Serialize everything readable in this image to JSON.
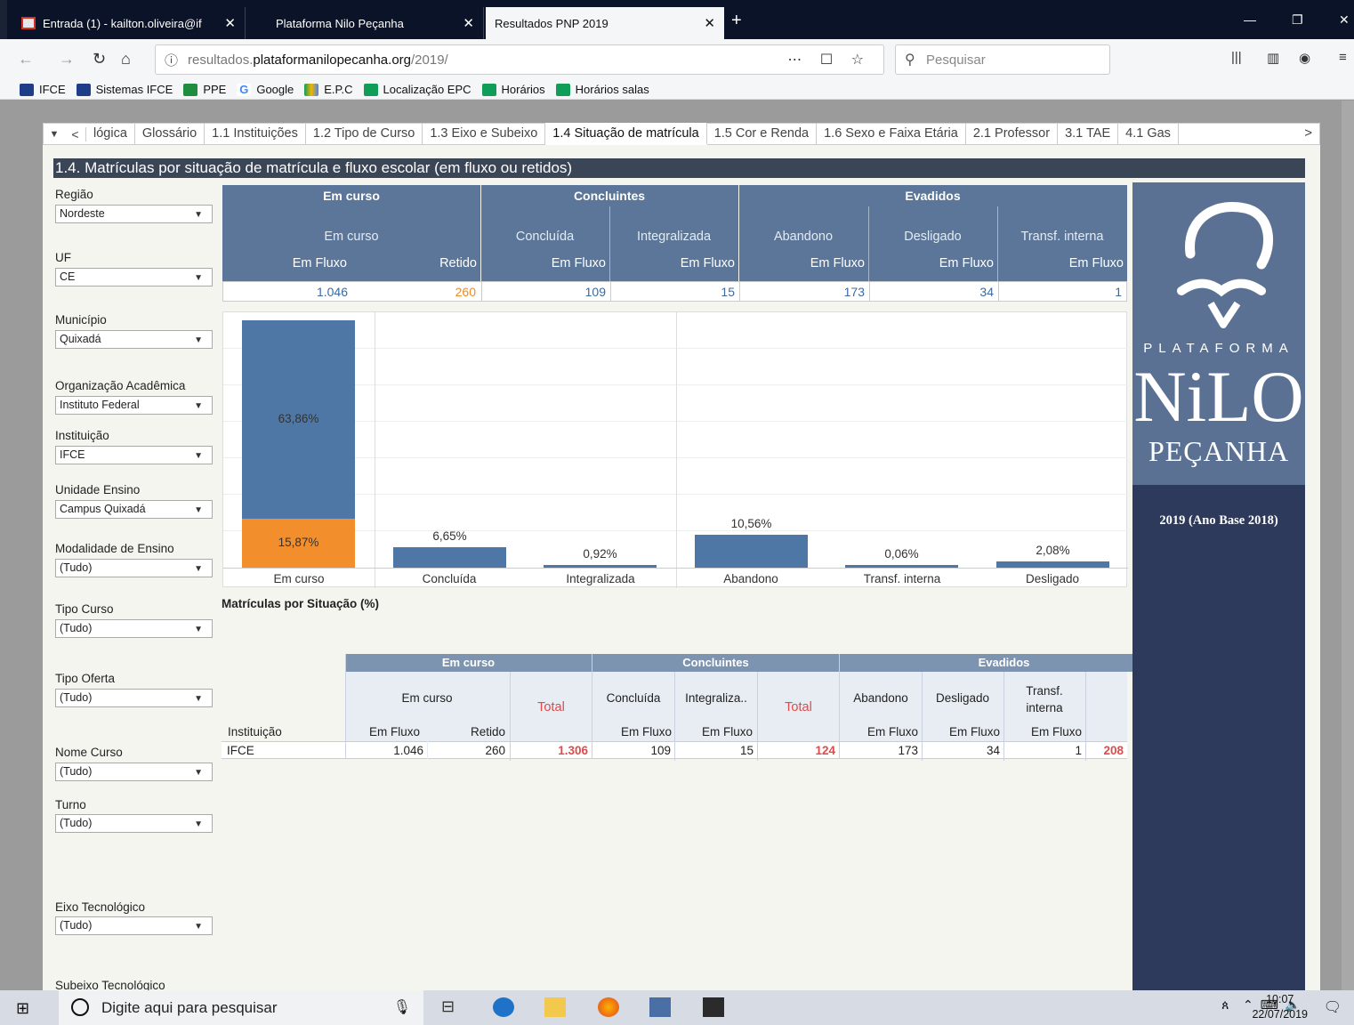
{
  "browser": {
    "tabs": [
      {
        "title": "Entrada (1) - kailton.oliveira@if"
      },
      {
        "title": "Plataforma Nilo Peçanha"
      },
      {
        "title": "Resultados PNP 2019"
      }
    ],
    "url_prefix": "resultados.",
    "url_domain": "plataformanilopecanha.org",
    "url_path": "/2019/",
    "search_placeholder": "Pesquisar",
    "bookmarks": [
      {
        "label": "IFCE",
        "color": "#1f3c88"
      },
      {
        "label": "Sistemas IFCE",
        "color": "#1f3c88"
      },
      {
        "label": "PPE",
        "color": "#1e8e3e"
      },
      {
        "label": "Google",
        "color": "#4285f4"
      },
      {
        "label": "E.P.C",
        "color": "#f4b400"
      },
      {
        "label": "Localização EPC",
        "color": "#0f9d58"
      },
      {
        "label": "Horários",
        "color": "#0f9d58"
      },
      {
        "label": "Horários salas",
        "color": "#0f9d58"
      }
    ]
  },
  "sheet_tabs": [
    "lógica",
    "Glossário",
    "1.1 Instituições",
    "1.2 Tipo de Curso",
    "1.3 Eixo e Subeixo",
    "1.4 Situação de matrícula",
    "1.5 Cor e Renda",
    "1.6 Sexo e Faixa Etária",
    "2.1 Professor",
    "3.1 TAE",
    "4.1 Gas"
  ],
  "dashboard_title": "1.4. Matrículas por situação de matrícula e fluxo escolar (em fluxo ou retidos)",
  "filters": [
    {
      "label": "Região",
      "value": "Nordeste"
    },
    {
      "label": "UF",
      "value": "CE"
    },
    {
      "label": "Município",
      "value": "Quixadá"
    },
    {
      "label": "Organização Acadêmica",
      "value": "Instituto Federal"
    },
    {
      "label": "Instituição",
      "value": "IFCE"
    },
    {
      "label": "Unidade Ensino",
      "value": "Campus Quixadá"
    },
    {
      "label": "Modalidade de Ensino",
      "value": "(Tudo)"
    },
    {
      "label": "Tipo Curso",
      "value": "(Tudo)"
    },
    {
      "label": "Tipo Oferta",
      "value": "(Tudo)"
    },
    {
      "label": "Nome Curso",
      "value": "(Tudo)"
    },
    {
      "label": "Turno",
      "value": "(Tudo)"
    },
    {
      "label": "Eixo Tecnológico",
      "value": "(Tudo)"
    },
    {
      "label": "Subeixo Tecnológico",
      "value": ""
    }
  ],
  "summary": {
    "groups": [
      "Em curso",
      "Concluintes",
      "Evadidos"
    ],
    "subs": [
      "Em curso",
      "Concluída",
      "Integralizada",
      "Abandono",
      "Desligado",
      "Transf. interna"
    ],
    "flux": [
      "Em Fluxo",
      "Retido",
      "Em Fluxo",
      "Em Fluxo",
      "Em Fluxo",
      "Em Fluxo",
      "Em Fluxo"
    ],
    "values": [
      "1.046",
      "260",
      "109",
      "15",
      "173",
      "34",
      "1"
    ]
  },
  "chart_data": {
    "type": "bar",
    "title": "Matrículas por Situação (%)",
    "categories": [
      "Em curso",
      "Concluída",
      "Integralizada",
      "Abandono",
      "Transf. interna",
      "Desligado"
    ],
    "series": [
      {
        "name": "Em Fluxo",
        "values": [
          63.86,
          6.65,
          0.92,
          10.56,
          0.06,
          2.08
        ],
        "labels": [
          "63,86%",
          "6,65%",
          "0,92%",
          "10,56%",
          "0,06%",
          "2,08%"
        ],
        "color": "#4e77a5"
      },
      {
        "name": "Retido",
        "values": [
          15.87,
          0,
          0,
          0,
          0,
          0
        ],
        "labels": [
          "15,87%",
          "",
          "",
          "",
          "",
          ""
        ],
        "color": "#f28e2b"
      }
    ],
    "ylim": [
      0,
      80
    ]
  },
  "detail": {
    "groups": [
      "Em curso",
      "Concluintes",
      "Evadidos"
    ],
    "col_instituicao": "Instituição",
    "subs": [
      "Em curso",
      "Concluída",
      "Integraliza..",
      "Abandono",
      "Desligado",
      "Transf. interna"
    ],
    "total_label": "Total",
    "flux": [
      "Em Fluxo",
      "Retido",
      "Em Fluxo",
      "Em Fluxo",
      "Em Fluxo",
      "Em Fluxo",
      "Em Fluxo"
    ],
    "row": {
      "inst": "IFCE",
      "values": [
        "1.046",
        "260",
        "1.306",
        "109",
        "15",
        "124",
        "173",
        "34",
        "1",
        "208"
      ]
    }
  },
  "logo": {
    "plataforma": "PLATAFORMA",
    "nilo": "NiLO",
    "pecanha": "PEÇANHA",
    "year": "2019 (Ano Base 2018)"
  },
  "taskbar": {
    "search_placeholder": "Digite aqui para pesquisar",
    "time": "10:07",
    "date": "22/07/2019"
  }
}
